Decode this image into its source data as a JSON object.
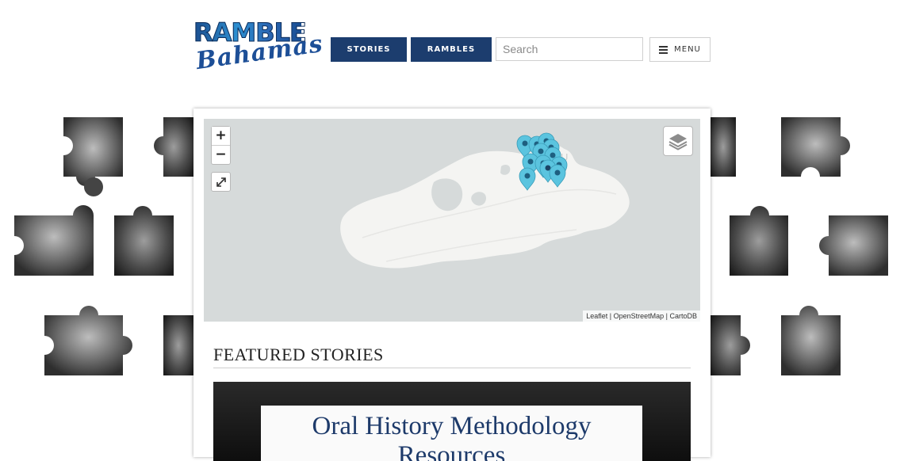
{
  "header": {
    "logo_top": "RAMBLE",
    "logo_bottom": "Bahamas",
    "nav": [
      {
        "label": "STORIES"
      },
      {
        "label": "RAMBLES"
      }
    ],
    "search_placeholder": "Search",
    "menu_label": "MENU"
  },
  "map": {
    "zoom_in": "+",
    "zoom_out": "−",
    "attribution": {
      "leaflet": "Leaflet",
      "osm": "OpenStreetMap",
      "carto": "CartoDB",
      "separator": " | "
    },
    "marker_color": "#5bc4df",
    "land_color": "#f4f4f2",
    "water_color": "#d6dada"
  },
  "featured": {
    "heading": "FEATURED STORIES",
    "story_title": "Oral History Methodology Resources"
  },
  "colors": {
    "nav_bg": "#1c3d6e",
    "brand_blue": "#1d4f97"
  }
}
